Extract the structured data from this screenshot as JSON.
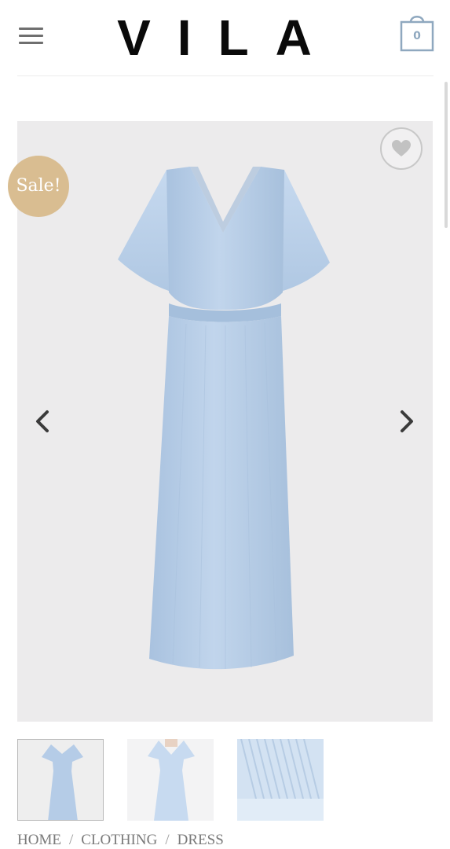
{
  "header": {
    "brand": "VILA",
    "cart_count": "0"
  },
  "product": {
    "badge": "Sale!",
    "image": "light-blue-pleated-maxi-dress",
    "thumbnails": [
      "dress-front",
      "dress-model",
      "fabric-detail"
    ]
  },
  "breadcrumb": {
    "items": [
      "HOME",
      "CLOTHING",
      "DRESS"
    ],
    "separator": "/"
  },
  "icons": {
    "menu": "hamburger-menu-icon",
    "cart": "shopping-bag-icon",
    "wishlist": "heart-icon",
    "prev": "chevron-left-icon",
    "next": "chevron-right-icon"
  },
  "colors": {
    "sale_badge": "#d9bd91",
    "dress": "#b9d0ea",
    "cart_accent": "#8fa8bf",
    "gallery_bg": "#ecebec"
  }
}
